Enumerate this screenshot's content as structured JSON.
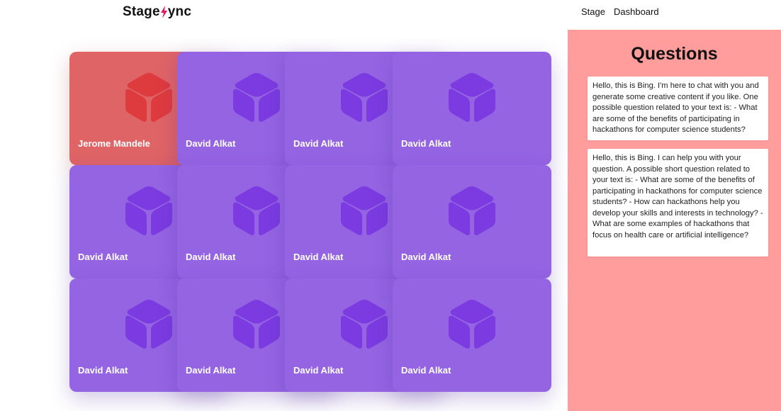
{
  "header": {
    "logo_left": "Stage",
    "logo_right": "ync",
    "nav": {
      "stage_label": "Stage",
      "dashboard_label": "Dashboard"
    }
  },
  "grid": {
    "tiles": [
      {
        "name": "Jerome Mandele",
        "active": true
      },
      {
        "name": "David Alkat",
        "active": false
      },
      {
        "name": "David Alkat",
        "active": false
      },
      {
        "name": "David Alkat",
        "active": false
      },
      {
        "name": "David Alkat",
        "active": false
      },
      {
        "name": "David Alkat",
        "active": false
      },
      {
        "name": "David Alkat",
        "active": false
      },
      {
        "name": "David Alkat",
        "active": false
      },
      {
        "name": "David Alkat",
        "active": false
      },
      {
        "name": "David Alkat",
        "active": false
      },
      {
        "name": "David Alkat",
        "active": false
      },
      {
        "name": "David Alkat",
        "active": false
      }
    ]
  },
  "questions": {
    "title": "Questions",
    "items": [
      "Hello, this is Bing. I'm here to chat with you and generate some creative content if you like. One possible question related to your text is: - What are some of the benefits of participating in hackathons for computer science students?",
      "Hello, this is Bing. I can help you with your question. A possible short question related to your text is: - What are some of the benefits of participating in hackathons for computer science students? - How can hackathons help you develop your skills and interests in technology? - What are some examples of hackathons that focus on health care or artificial intelligence?"
    ]
  },
  "colors": {
    "tile_default": "#9464e3",
    "tile_active": "#df6466",
    "cube_default": "#7b3be0",
    "cube_active": "#de3b3e",
    "panel_bg": "#ff9c9c",
    "logo_accent": "#e8175d"
  }
}
